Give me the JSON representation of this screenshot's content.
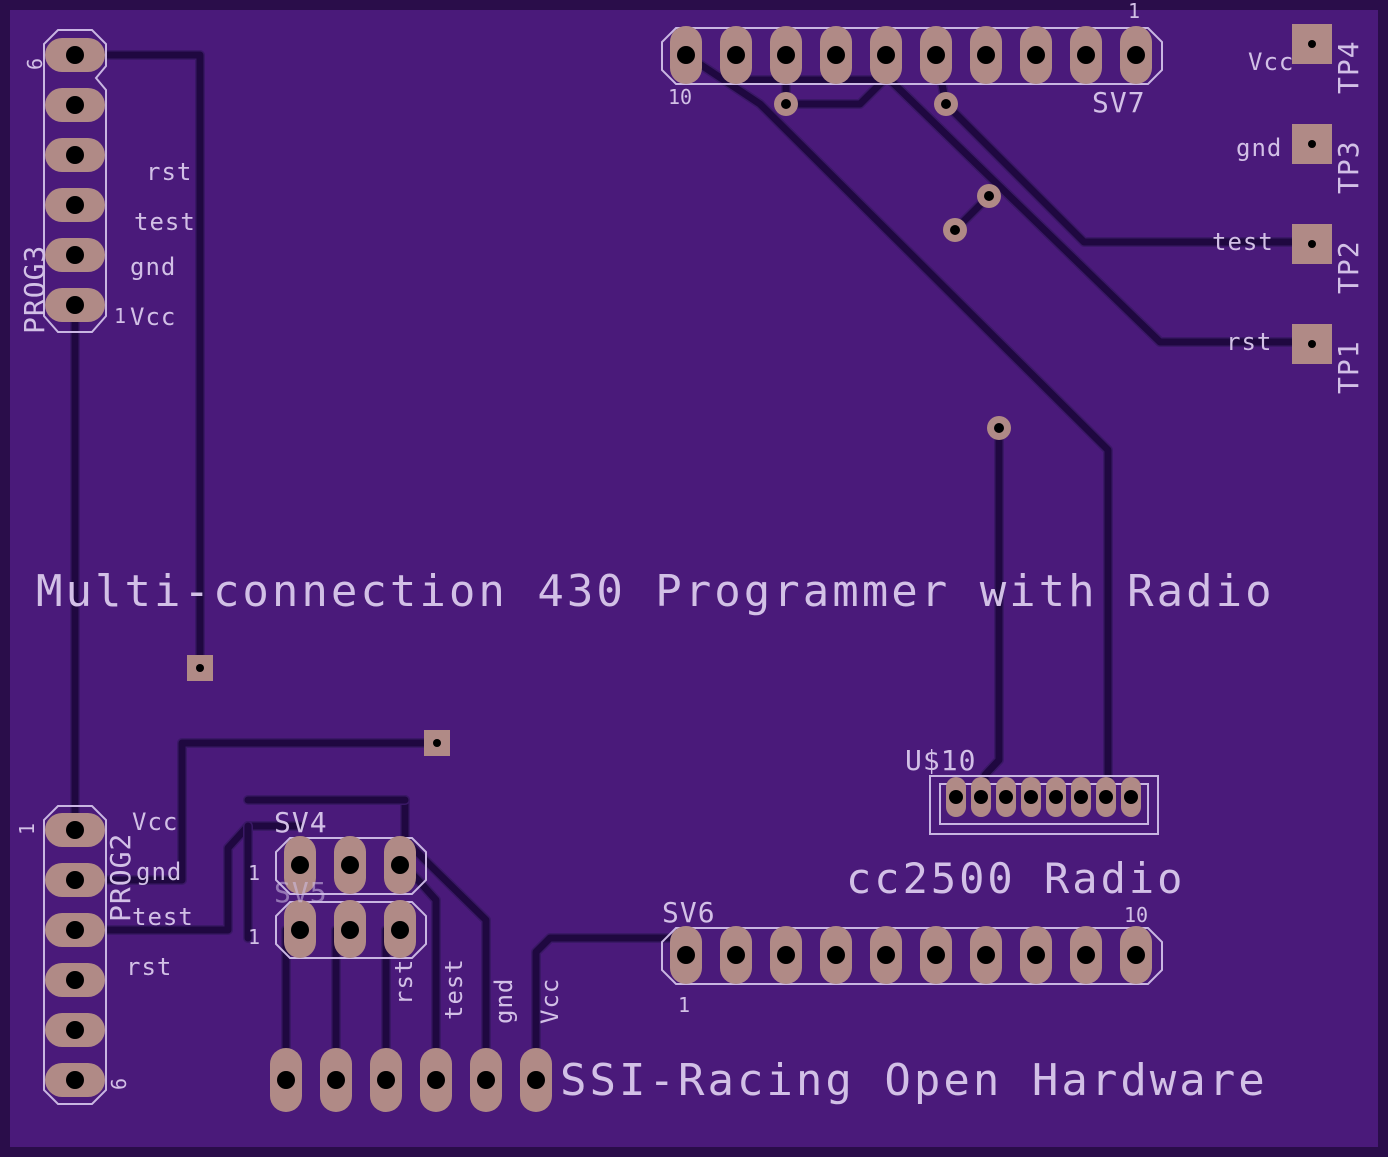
{
  "board": {
    "title": "Multi-connection 430 Programmer with Radio",
    "footer": "SSI-Racing Open Hardware",
    "radio_label": "cc2500 Radio"
  },
  "prog3": {
    "ref": "PROG3",
    "pin_first": "6",
    "pin_last": "1",
    "labels": {
      "rst": "rst",
      "test": "test",
      "gnd": "gnd",
      "vcc": "Vcc"
    }
  },
  "prog2": {
    "ref": "PROG2",
    "pin_first": "1",
    "pin_last": "6",
    "labels": {
      "vcc": "Vcc",
      "gnd": "gnd",
      "test": "test",
      "rst": "rst"
    }
  },
  "sv7": {
    "ref": "SV7",
    "pin_left": "10",
    "pin_right": "1"
  },
  "sv6": {
    "ref": "SV6",
    "pin_left": "1",
    "pin_right": "10"
  },
  "sv4": {
    "ref": "SV4",
    "pin": "1"
  },
  "sv5": {
    "ref": "SV5",
    "pin": "1"
  },
  "u10": {
    "ref": "U$10"
  },
  "testpoints": [
    {
      "ref": "TP4",
      "label": "Vcc"
    },
    {
      "ref": "TP3",
      "label": "gnd"
    },
    {
      "ref": "TP2",
      "label": "test"
    },
    {
      "ref": "TP1",
      "label": "rst"
    }
  ],
  "bottom_header": {
    "labels": {
      "rst": "rst",
      "test": "test",
      "gnd": "gnd",
      "vcc": "Vcc"
    }
  },
  "colors": {
    "board": "#4a1a7a",
    "trace": "#1f0840",
    "pad": "#b08a86",
    "silk": "#d2c0e6"
  }
}
